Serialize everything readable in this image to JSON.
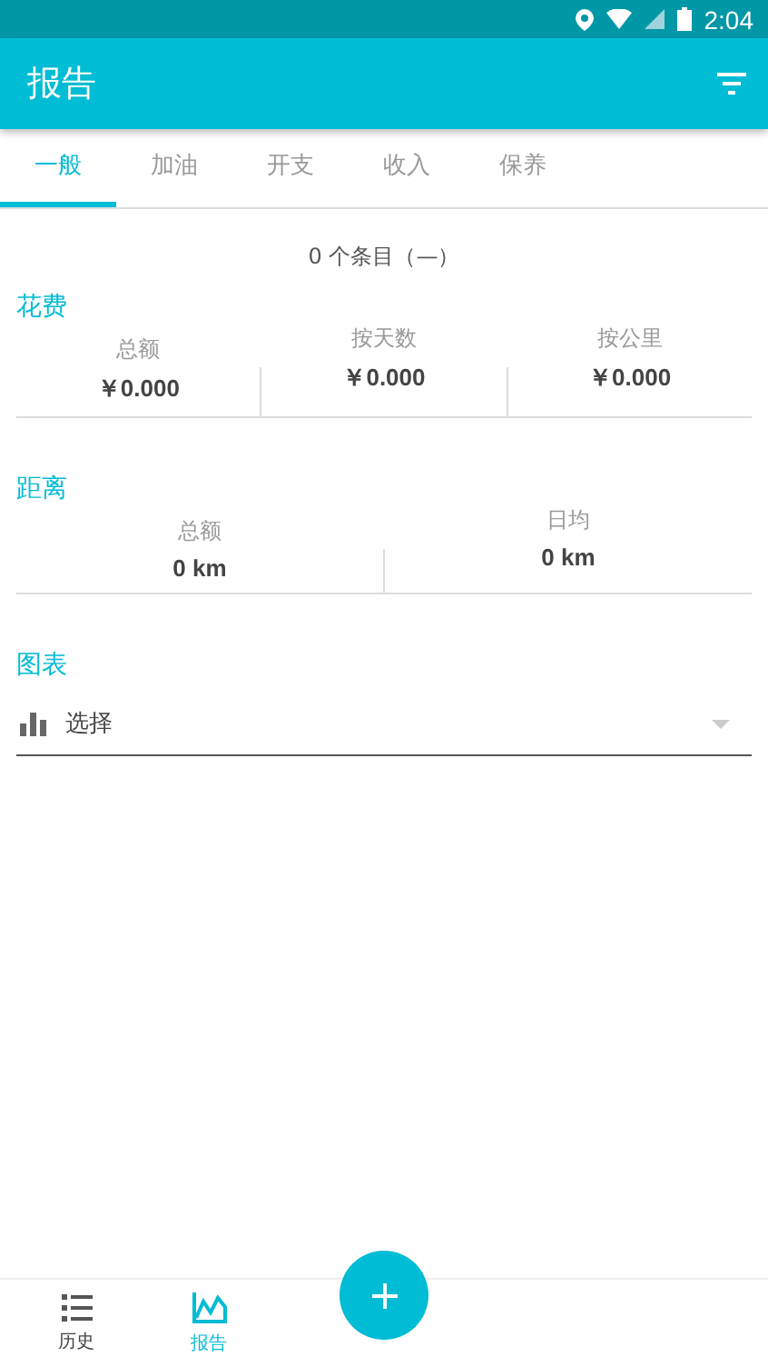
{
  "status_bar": {
    "time": "2:04"
  },
  "app_bar": {
    "title": "报告"
  },
  "tabs": [
    {
      "label": "一般",
      "selected": true
    },
    {
      "label": "加油",
      "selected": false
    },
    {
      "label": "开支",
      "selected": false
    },
    {
      "label": "收入",
      "selected": false
    },
    {
      "label": "保养",
      "selected": false
    }
  ],
  "summary": "0 个条目（—）",
  "sections": [
    {
      "title": "花费",
      "stats": [
        {
          "label": "总额",
          "value": "￥0.000"
        },
        {
          "label": "按天数",
          "value": "￥0.000"
        },
        {
          "label": "按公里",
          "value": "￥0.000"
        }
      ]
    },
    {
      "title": "距离",
      "stats": [
        {
          "label": "总额",
          "value": "0 km"
        },
        {
          "label": "日均",
          "value": "0 km"
        }
      ]
    }
  ],
  "chart": {
    "title": "图表",
    "select_value": "选择"
  },
  "bottom_nav": [
    {
      "label": "历史",
      "kind": "list",
      "selected": false
    },
    {
      "label": "报告",
      "kind": "chart",
      "selected": true
    }
  ]
}
